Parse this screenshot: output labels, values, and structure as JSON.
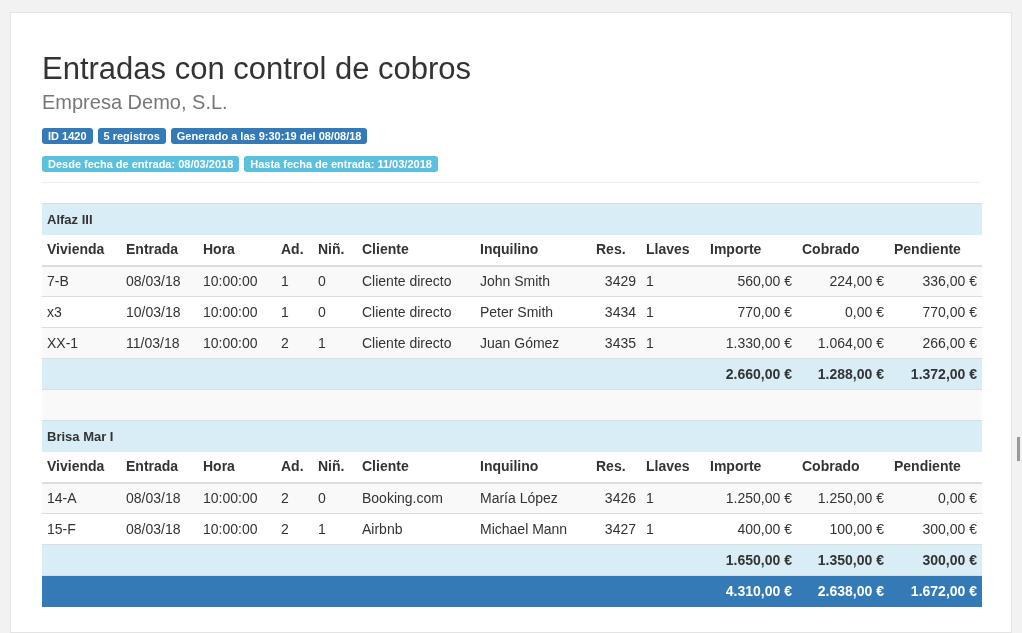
{
  "title": "Entradas con control de cobros",
  "subtitle": "Empresa Demo, S.L.",
  "badge_rows": [
    [
      {
        "text": "ID 1420",
        "kind": "primary"
      },
      {
        "text": "5 registros",
        "kind": "primary"
      },
      {
        "text": "Generado a las 9:30:19 del 08/08/18",
        "kind": "primary"
      }
    ],
    [
      {
        "text": "Desde fecha de entrada: 08/03/2018",
        "kind": "info"
      },
      {
        "text": "Hasta fecha de entrada: 11/03/2018",
        "kind": "info"
      }
    ]
  ],
  "groups": [
    {
      "name": "Alfaz III",
      "columns": [
        "Vivienda",
        "Entrada",
        "Hora",
        "Ad.",
        "Niñ.",
        "Cliente",
        "Inquilino",
        "Res.",
        "Llaves",
        "Importe",
        "Cobrado",
        "Pendiente"
      ],
      "rows": [
        [
          "7-B",
          "08/03/18",
          "10:00:00",
          "1",
          "0",
          "Cliente directo",
          "John Smith",
          "3429",
          "1",
          "560,00 €",
          "224,00 €",
          "336,00 €"
        ],
        [
          "x3",
          "10/03/18",
          "10:00:00",
          "1",
          "0",
          "Cliente directo",
          "Peter Smith",
          "3434",
          "1",
          "770,00 €",
          "0,00 €",
          "770,00 €"
        ],
        [
          "XX-1",
          "11/03/18",
          "10:00:00",
          "2",
          "1",
          "Cliente directo",
          "Juan Gómez",
          "3435",
          "1",
          "1.330,00 €",
          "1.064,00 €",
          "266,00 €"
        ]
      ],
      "totals": [
        "2.660,00 €",
        "1.288,00 €",
        "1.372,00 €"
      ]
    },
    {
      "name": "Brisa Mar I",
      "columns": [
        "Vivienda",
        "Entrada",
        "Hora",
        "Ad.",
        "Niñ.",
        "Cliente",
        "Inquilino",
        "Res.",
        "Llaves",
        "Importe",
        "Cobrado",
        "Pendiente"
      ],
      "rows": [
        [
          "14-A",
          "08/03/18",
          "10:00:00",
          "2",
          "0",
          "Booking.com",
          "María López",
          "3426",
          "1",
          "1.250,00 €",
          "1.250,00 €",
          "0,00 €"
        ],
        [
          "15-F",
          "08/03/18",
          "10:00:00",
          "2",
          "1",
          "Airbnb",
          "Michael Mann",
          "3427",
          "1",
          "400,00 €",
          "100,00 €",
          "300,00 €"
        ]
      ],
      "totals": [
        "1.650,00 €",
        "1.350,00 €",
        "300,00 €"
      ]
    }
  ],
  "grand_total": [
    "4.310,00 €",
    "2.638,00 €",
    "1.672,00 €"
  ]
}
